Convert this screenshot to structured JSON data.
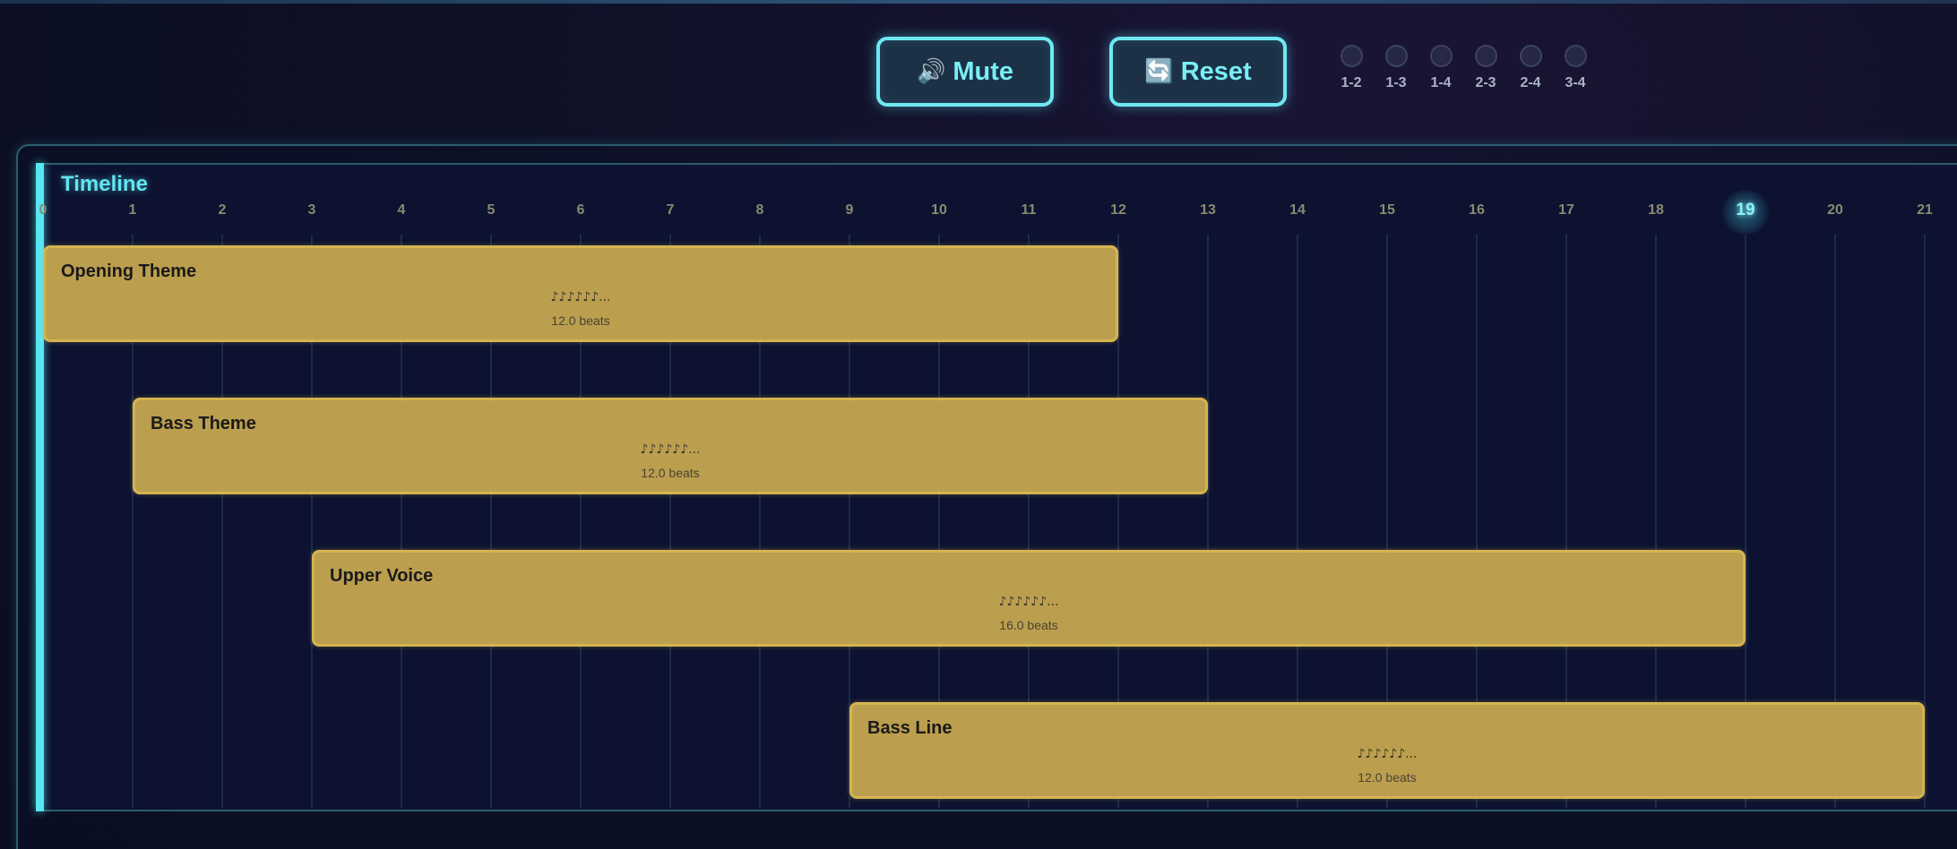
{
  "controls": {
    "mute": {
      "icon": "speaker-icon",
      "glyph": "🔊",
      "label": "Mute"
    },
    "reset": {
      "icon": "reset-icon",
      "glyph": "🔄",
      "label": "Reset"
    }
  },
  "voice_pairs": [
    "1-2",
    "1-3",
    "1-4",
    "2-3",
    "2-4",
    "3-4"
  ],
  "timeline": {
    "title": "Timeline",
    "ticks": [
      "0",
      "1",
      "2",
      "3",
      "4",
      "5",
      "6",
      "7",
      "8",
      "9",
      "10",
      "11",
      "12",
      "13",
      "14",
      "15",
      "16",
      "17",
      "18",
      "19",
      "20",
      "21"
    ],
    "current_beat": 19,
    "blocks": [
      {
        "name": "Opening Theme",
        "notes": "♪♪♪♪♪♪...",
        "beats": "12.0 beats",
        "start": 0,
        "length": 12
      },
      {
        "name": "Bass Theme",
        "notes": "♪♪♪♪♪♪...",
        "beats": "12.0 beats",
        "start": 1,
        "length": 12
      },
      {
        "name": "Upper Voice",
        "notes": "♪♪♪♪♪♪...",
        "beats": "16.0 beats",
        "start": 3,
        "length": 16
      },
      {
        "name": "Bass Line",
        "notes": "♪♪♪♪♪♪...",
        "beats": "12.0 beats",
        "start": 9,
        "length": 12
      }
    ]
  },
  "colors": {
    "accent": "#6ee9f2",
    "block_fill": "#c5a650",
    "block_border": "#d4b451",
    "background": "#0c1230"
  }
}
